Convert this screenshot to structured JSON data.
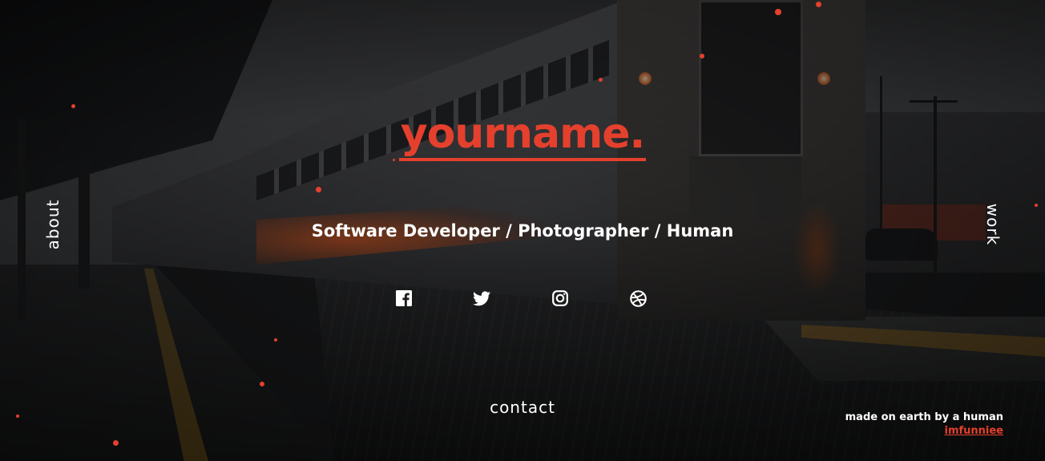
{
  "brand": {
    "name": "yourname.",
    "accent_color": "#e5402d"
  },
  "hero": {
    "tagline": "Software Developer / Photographer / Human"
  },
  "socials": [
    {
      "icon": "facebook-icon"
    },
    {
      "icon": "twitter-icon"
    },
    {
      "icon": "instagram-icon"
    },
    {
      "icon": "dribbble-icon"
    }
  ],
  "nav": {
    "left": "about",
    "right": "work",
    "bottom": "contact"
  },
  "footer": {
    "credit": "made on earth by a human",
    "handle": "imfunniee"
  },
  "background": {
    "description_icon": "train-station-photo"
  }
}
